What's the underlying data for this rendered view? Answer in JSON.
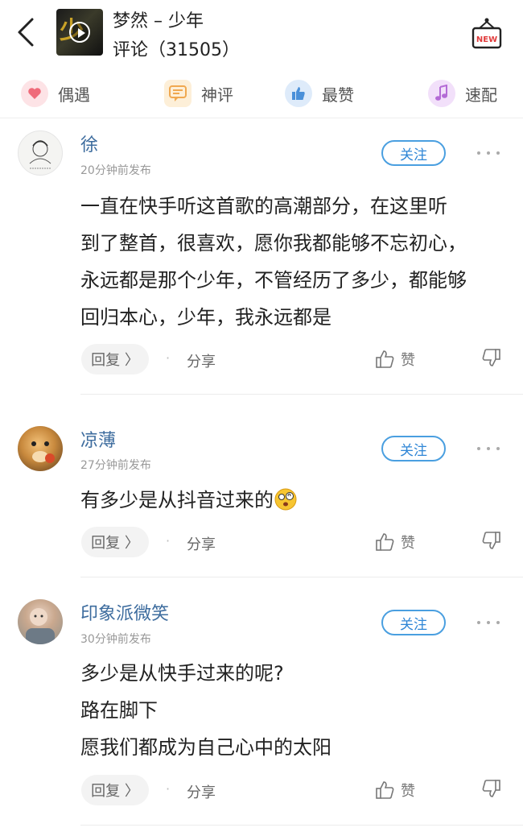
{
  "header": {
    "song_title": "梦然 – 少年",
    "comment_count": "评论（31505）",
    "cover_glyph": "少"
  },
  "filters": [
    {
      "label": "偶遇",
      "icon": "heart-icon",
      "color": "#ef6b7a"
    },
    {
      "label": "神评",
      "icon": "message-icon",
      "color": "#f0a850"
    },
    {
      "label": "最赞",
      "icon": "thumbs-up-icon",
      "color": "#4a90d9"
    },
    {
      "label": "速配",
      "icon": "music-note-icon",
      "color": "#b46bd6"
    }
  ],
  "comments": [
    {
      "user": "徐",
      "time": "20分钟前发布",
      "follow": "关注",
      "lines": [
        "一直在快手听这首歌的高潮部分，在这里听",
        "到了整首，很喜欢，愿你我都能够不忘初心，",
        "永远都是那个少年，不管经历了多少，都能够",
        "回归本心，少年，我永远都是"
      ],
      "reply": "回复 〉",
      "share": "分享",
      "like": "赞"
    },
    {
      "user": "凉薄",
      "time": "27分钟前发布",
      "follow": "关注",
      "lines": [
        "有多少是从抖音过来的"
      ],
      "reply": "回复 〉",
      "share": "分享",
      "like": "赞"
    },
    {
      "user": "印象派微笑",
      "time": "30分钟前发布",
      "follow": "关注",
      "lines": [
        "多少是从快手过来的呢?",
        "路在脚下",
        "愿我们都成为自己心中的太阳"
      ],
      "reply": "回复 〉",
      "share": "分享",
      "like": "赞"
    }
  ],
  "separator_dot": "·"
}
